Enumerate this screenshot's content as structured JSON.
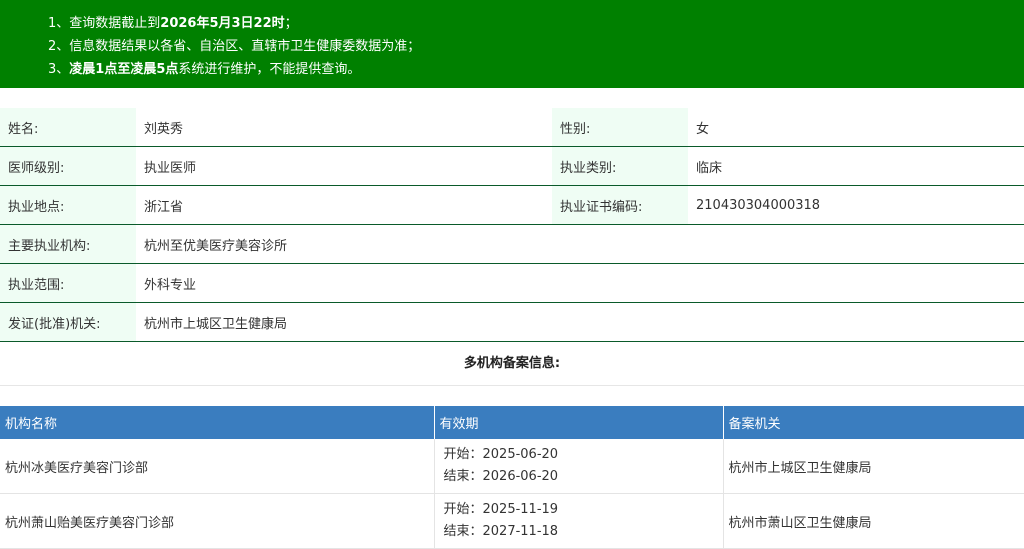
{
  "notice": {
    "line1_prefix": "1、查询数据截止到",
    "line1_bold": "2026年5月3日22时",
    "line1_suffix": "；",
    "line2": "2、信息数据结果以各省、自治区、直辖市卫生健康委数据为准；",
    "line3_prefix": "3、",
    "line3_bold": "凌晨1点至凌晨5点",
    "line3_suffix": "系统进行维护，不能提供查询。"
  },
  "info": {
    "name_label": "姓名:",
    "name_value": "刘英秀",
    "gender_label": "性别:",
    "gender_value": "女",
    "level_label": "医师级别:",
    "level_value": "执业医师",
    "category_label": "执业类别:",
    "category_value": "临床",
    "location_label": "执业地点:",
    "location_value": "浙江省",
    "cert_label": "执业证书编码:",
    "cert_value": "210430304000318",
    "org_label": "主要执业机构:",
    "org_value": "杭州至优美医疗美容诊所",
    "scope_label": "执业范围:",
    "scope_value": "外科专业",
    "authority_label": "发证(批准)机关:",
    "authority_value": "杭州市上城区卫生健康局"
  },
  "multi": {
    "title": "多机构备案信息:",
    "headers": {
      "org": "机构名称",
      "period": "有效期",
      "authority": "备案机关"
    },
    "rows": [
      {
        "org": "杭州冰美医疗美容门诊部",
        "start": "开始：2025-06-20",
        "end": "结束：2026-06-20",
        "authority": "杭州市上城区卫生健康局"
      },
      {
        "org": "杭州萧山贻美医疗美容门诊部",
        "start": "开始：2025-11-19",
        "end": "结束：2027-11-18",
        "authority": "杭州市萧山区卫生健康局"
      }
    ]
  },
  "colors": {
    "notice_bg": "#008000",
    "label_bg": "#effdf4",
    "table_header_bg": "#3a7dbf"
  }
}
